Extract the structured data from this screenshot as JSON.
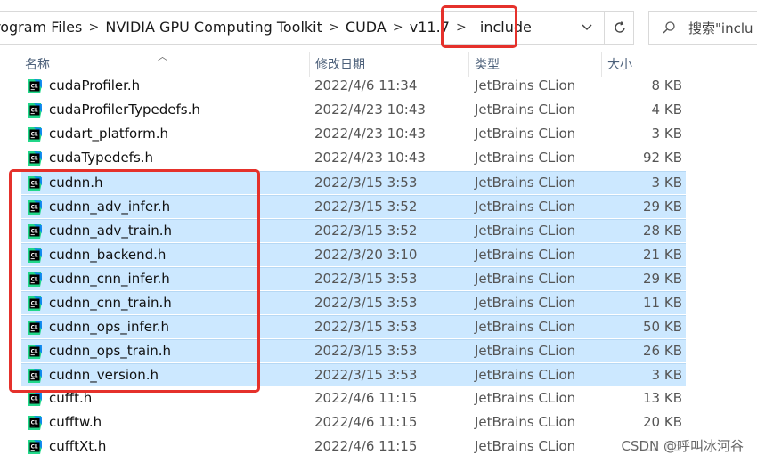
{
  "address_bar": {
    "crumbs": [
      "rogram Files",
      "NVIDIA GPU Computing Toolkit",
      "CUDA",
      "v11.7"
    ],
    "current": "include",
    "separator": ">"
  },
  "search": {
    "placeholder": "搜索\"inclu"
  },
  "columns": {
    "name": "名称",
    "date": "修改日期",
    "type": "类型",
    "size": "大小"
  },
  "files": [
    {
      "name": "cudaProfiler.h",
      "date": "2022/4/6 11:34",
      "type": "JetBrains CLion",
      "size": "8 KB",
      "selected": false
    },
    {
      "name": "cudaProfilerTypedefs.h",
      "date": "2022/4/23 10:43",
      "type": "JetBrains CLion",
      "size": "4 KB",
      "selected": false
    },
    {
      "name": "cudart_platform.h",
      "date": "2022/4/23 10:43",
      "type": "JetBrains CLion",
      "size": "3 KB",
      "selected": false
    },
    {
      "name": "cudaTypedefs.h",
      "date": "2022/4/23 10:43",
      "type": "JetBrains CLion",
      "size": "92 KB",
      "selected": false
    },
    {
      "name": "cudnn.h",
      "date": "2022/3/15 3:53",
      "type": "JetBrains CLion",
      "size": "3 KB",
      "selected": true
    },
    {
      "name": "cudnn_adv_infer.h",
      "date": "2022/3/15 3:52",
      "type": "JetBrains CLion",
      "size": "29 KB",
      "selected": true
    },
    {
      "name": "cudnn_adv_train.h",
      "date": "2022/3/15 3:52",
      "type": "JetBrains CLion",
      "size": "28 KB",
      "selected": true
    },
    {
      "name": "cudnn_backend.h",
      "date": "2022/3/20 3:10",
      "type": "JetBrains CLion",
      "size": "21 KB",
      "selected": true
    },
    {
      "name": "cudnn_cnn_infer.h",
      "date": "2022/3/15 3:53",
      "type": "JetBrains CLion",
      "size": "29 KB",
      "selected": true
    },
    {
      "name": "cudnn_cnn_train.h",
      "date": "2022/3/15 3:53",
      "type": "JetBrains CLion",
      "size": "11 KB",
      "selected": true
    },
    {
      "name": "cudnn_ops_infer.h",
      "date": "2022/3/15 3:53",
      "type": "JetBrains CLion",
      "size": "50 KB",
      "selected": true
    },
    {
      "name": "cudnn_ops_train.h",
      "date": "2022/3/15 3:53",
      "type": "JetBrains CLion",
      "size": "26 KB",
      "selected": true
    },
    {
      "name": "cudnn_version.h",
      "date": "2022/3/15 3:53",
      "type": "JetBrains CLion",
      "size": "3 KB",
      "selected": true
    },
    {
      "name": "cufft.h",
      "date": "2022/4/6 11:15",
      "type": "JetBrains CLion",
      "size": "13 KB",
      "selected": false
    },
    {
      "name": "cufftw.h",
      "date": "2022/4/6 11:15",
      "type": "JetBrains CLion",
      "size": "20 KB",
      "selected": false
    },
    {
      "name": "cufftXt.h",
      "date": "2022/4/6 11:15",
      "type": "JetBrains CLion",
      "size": "12 KB",
      "selected": false
    }
  ],
  "file_icon": "clion-file-icon",
  "watermark": "CSDN @呼叫冰河谷",
  "colors": {
    "selection": "#cce8ff",
    "highlight_box": "#e5312b",
    "header_text": "#4c607a"
  }
}
